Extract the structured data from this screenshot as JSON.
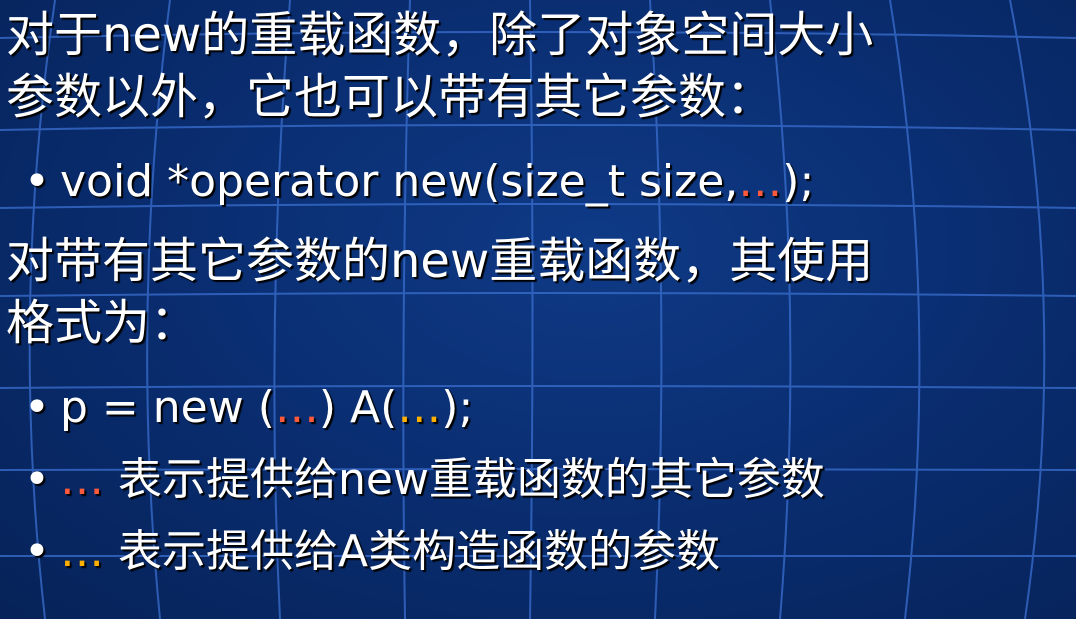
{
  "slide": {
    "paragraph1": {
      "line1": "对于new的重载函数，除了对象空间大小",
      "line2": "参数以外，它也可以带有其它参数："
    },
    "bullet1": {
      "symbol": "•",
      "prefix": "void *operator new(size_t size,",
      "highlight": "…",
      "suffix": ");"
    },
    "paragraph2": {
      "line1": "对带有其它参数的new重载函数，其使用",
      "line2": "格式为："
    },
    "bullet2": {
      "symbol": "•",
      "part1": "p = new (",
      "highlight1": "…",
      "part2": ") A(",
      "highlight2": "…",
      "part3": ");"
    },
    "bullet3": {
      "symbol": "•",
      "highlight": "…",
      "text": " 表示提供给new重载函数的其它参数"
    },
    "bullet4": {
      "symbol": "•",
      "highlight": "…",
      "text": " 表示提供给A类构造函数的参数"
    }
  },
  "colors": {
    "background": "#0a2e72",
    "text": "#ffffff",
    "highlight_new_args": "#ff5a3c",
    "highlight_ctor_args": "#ffb000",
    "grid_lines": "#3a6fd0"
  }
}
